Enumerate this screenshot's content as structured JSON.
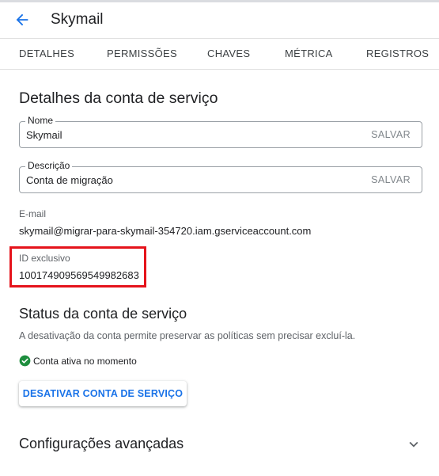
{
  "header": {
    "title": "Skymail",
    "back_icon": "arrow-back-icon"
  },
  "tabs": [
    {
      "label": "DETALHES"
    },
    {
      "label": "PERMISSÕES"
    },
    {
      "label": "CHAVES"
    },
    {
      "label": "MÉTRICA"
    },
    {
      "label": "REGISTROS"
    }
  ],
  "details": {
    "heading": "Detalhes da conta de serviço",
    "name_field": {
      "label": "Nome",
      "value": "Skymail",
      "save_label": "SALVAR"
    },
    "description_field": {
      "label": "Descrição",
      "value": "Conta de migração",
      "save_label": "SALVAR"
    },
    "email": {
      "label": "E-mail",
      "value": "skymail@migrar-para-skymail-354720.iam.gserviceaccount.com"
    },
    "unique_id": {
      "label": "ID exclusivo",
      "value": "100174909569549982683",
      "highlight_color": "#e5131b"
    }
  },
  "status_section": {
    "heading": "Status da conta de serviço",
    "description": "A desativação da conta permite preservar as políticas sem precisar excluí-la.",
    "status_text": "Conta ativa no momento",
    "status_icon": "check-circle-icon",
    "status_color": "#1e8e3e",
    "disable_button": "DESATIVAR CONTA DE SERVIÇO"
  },
  "advanced": {
    "heading": "Configurações avançadas",
    "toggle_icon": "chevron-down-icon"
  },
  "colors": {
    "accent": "#1a73e8",
    "text": "#202124",
    "muted": "#5f6368"
  }
}
